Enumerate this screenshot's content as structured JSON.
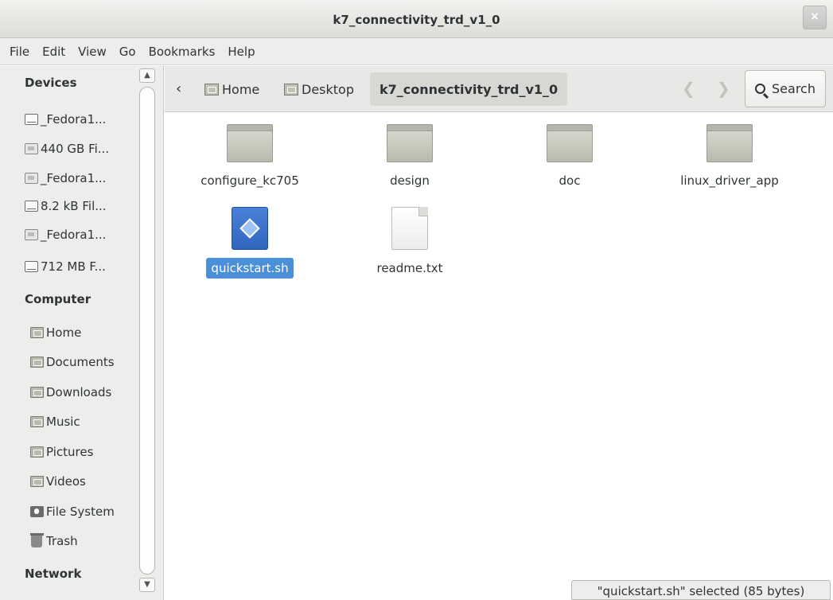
{
  "window": {
    "title": "k7_connectivity_trd_v1_0",
    "close_glyph": "×"
  },
  "menu": [
    "File",
    "Edit",
    "View",
    "Go",
    "Bookmarks",
    "Help"
  ],
  "sidebar": {
    "sections": [
      {
        "heading": "Devices"
      },
      {
        "heading": "Computer"
      },
      {
        "heading": "Network"
      }
    ],
    "devices": [
      {
        "label": "_Fedora1...",
        "icon": "drive-icon"
      },
      {
        "label": "440 GB Fi...",
        "icon": "disk-icon"
      },
      {
        "label": "_Fedora1...",
        "icon": "disk-icon"
      },
      {
        "label": "8.2 kB Fil...",
        "icon": "drive-icon"
      },
      {
        "label": "_Fedora1...",
        "icon": "disk-icon"
      },
      {
        "label": "712 MB F...",
        "icon": "drive-icon"
      }
    ],
    "places": [
      {
        "label": "Home",
        "icon": "home-folder-icon"
      },
      {
        "label": "Documents",
        "icon": "documents-folder-icon"
      },
      {
        "label": "Downloads",
        "icon": "downloads-folder-icon"
      },
      {
        "label": "Music",
        "icon": "music-folder-icon"
      },
      {
        "label": "Pictures",
        "icon": "pictures-folder-icon"
      },
      {
        "label": "Videos",
        "icon": "videos-folder-icon"
      },
      {
        "label": "File System",
        "icon": "filesystem-icon"
      },
      {
        "label": "Trash",
        "icon": "trash-icon"
      }
    ],
    "scroll_up_glyph": "▲",
    "scroll_down_glyph": "▼"
  },
  "toolbar": {
    "back_glyph": "‹",
    "breadcrumbs": [
      "Home",
      "Desktop",
      "k7_connectivity_trd_v1_0"
    ],
    "search_label": "Search",
    "nav_left_glyph": "❮",
    "nav_right_glyph": "❯"
  },
  "files": [
    {
      "name": "configure_kc705",
      "type": "folder"
    },
    {
      "name": "design",
      "type": "folder"
    },
    {
      "name": "doc",
      "type": "folder"
    },
    {
      "name": "linux_driver_app",
      "type": "folder"
    },
    {
      "name": "quickstart.sh",
      "type": "shell-script",
      "selected": true
    },
    {
      "name": "readme.txt",
      "type": "text"
    }
  ],
  "status": {
    "text": "\"quickstart.sh\" selected (85 bytes)"
  },
  "colors": {
    "selection": "#4a90d9",
    "sidebar_bg": "#ededeb",
    "content_bg": "#ffffff"
  }
}
